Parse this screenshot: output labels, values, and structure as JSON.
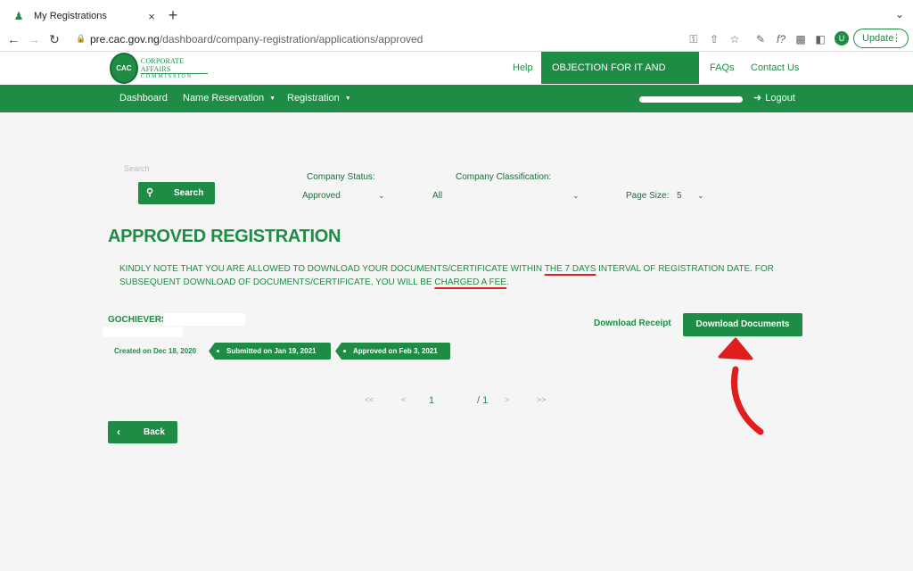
{
  "browser": {
    "tab_title": "My Registrations",
    "tab_close": "×",
    "new_tab": "+",
    "url_host": "pre.cac.gov.ng",
    "url_path": "/dashboard/company-registration/applications/approved",
    "update_label": "Update",
    "profile_initial": "U",
    "icons": [
      "back-icon",
      "forward-icon",
      "reload-icon",
      "lock-icon",
      "key-icon",
      "share-icon",
      "star-icon",
      "extension-icon",
      "puzzle-icon",
      "sidebar-icon",
      "more-icon"
    ]
  },
  "header": {
    "logo_line1": "CORPORATE AFFAIRS",
    "logo_line2": "COMMISSION",
    "logo_seal": "CAC",
    "nav": [
      "Help",
      "OBJECTION FOR IT AND LTD/GTE",
      "FAQs",
      "Contact Us"
    ]
  },
  "menubar": {
    "items": [
      "Dashboard",
      "Name Reservation",
      "Registration"
    ],
    "logout": "Logout"
  },
  "filters": {
    "search_placeholder": "Search",
    "search_button": "Search",
    "status_label": "Company Status:",
    "status_value": "Approved",
    "classification_label": "Company Classification:",
    "classification_value": "All",
    "page_size_label": "Page Size:",
    "page_size_value": "5"
  },
  "page": {
    "title": "APPROVED REGISTRATION",
    "note_part1": "KINDLY NOTE THAT YOU ARE ALLOWED TO DOWNLOAD YOUR DOCUMENTS/CERTIFICATE WITHIN ",
    "note_highlight1": "THE 7 DAYS",
    "note_part2": " INTERVAL OF REGISTRATION DATE. FOR SUBSEQUENT DOWNLOAD OF DOCUMENTS/CERTIFICATE, YOU WILL BE ",
    "note_highlight2": "CHARGED A FEE",
    "note_part3": "."
  },
  "application": {
    "company_name": "GOCHIEVERS",
    "download_receipt": "Download Receipt",
    "download_documents": "Download Documents",
    "created": "Created on Dec 18, 2020",
    "submitted": "Submitted on Jan 19, 2021",
    "approved": "Approved on Feb 3, 2021"
  },
  "pagination": {
    "first": "<<",
    "prev": "<",
    "current": "1",
    "total": "/ 1",
    "next": ">",
    "last": ">>"
  },
  "back_button": "Back",
  "colors": {
    "brand_green": "#1e8c45",
    "annotation_red": "#e01e1e"
  }
}
